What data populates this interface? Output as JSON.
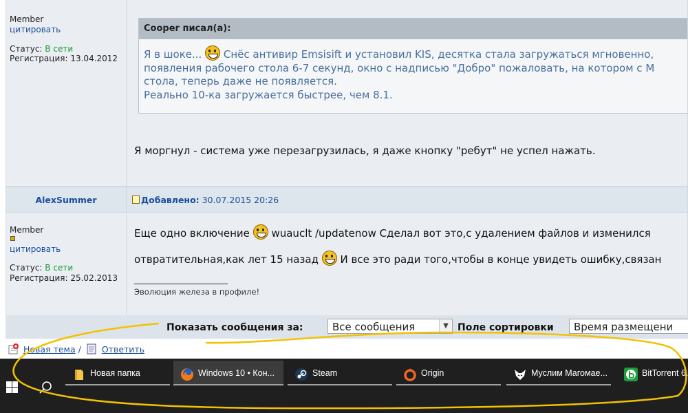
{
  "post1": {
    "user": {
      "rank": "Member",
      "quote_link": "цитировать",
      "status_label": "Статус:",
      "status_value": "В сети",
      "reg_label": "Регистрация:",
      "reg_date": "13.04.2012"
    },
    "quote": {
      "header": "Cooper писал(а):",
      "line1a": "Я в шоке...",
      "line1b": "Снёс антивир Emsisift и установил KIS, десятка стала загружаться мгновенно,",
      "line2": "появления рабочего стола 6-7 секунд, окно с надписью \"Добро\" пожаловать, на котором с М",
      "line3": "стола, теперь даже не появляется.",
      "line4": "Реально 10-ка загружается быстрее, чем 8.1."
    },
    "reply": "Я моргнул - система уже перезагрузилась, я даже кнопку \"ребут\" не успел нажать."
  },
  "post2": {
    "author": "AlexSummer",
    "added_label": "Добавлено:",
    "added_date": "30.07.2015 20:26",
    "user": {
      "rank": "Member",
      "quote_link": "цитировать",
      "status_label": "Статус:",
      "status_value": "В сети",
      "reg_label": "Регистрация:",
      "reg_date": "25.02.2013"
    },
    "line1a": "Еще одно включение",
    "line1b": "wuauclt /updatenow Сделал вот это,с удалением файлов и изменился",
    "line2a": "отвратительная,как лет 15 назад",
    "line2b": "И все это ради того,чтобы в конце увидеть ошибку,связан",
    "signature": "Эволюция железа в профиле!"
  },
  "toolbar": {
    "show_label": "Показать сообщения за:",
    "show_value": "Все сообщения",
    "sort_label": "Поле сортировки",
    "sort_value": "Время размещени"
  },
  "links": {
    "new_topic": "Новая тема",
    "separator": "/",
    "reply": "Ответить"
  },
  "taskbar": {
    "items": [
      {
        "label": "Новая папка",
        "icon": "folder-icon"
      },
      {
        "label": "Windows 10 • Кон...",
        "icon": "firefox-icon"
      },
      {
        "label": "Steam",
        "icon": "steam-icon"
      },
      {
        "label": "Origin",
        "icon": "origin-icon"
      },
      {
        "label": "Муслим Магомае...",
        "icon": "fox-icon"
      },
      {
        "label": "BitTorrent 6.",
        "icon": "bittorrent-icon"
      }
    ]
  },
  "colors": {
    "link": "#1a4e9c",
    "online": "#189a32",
    "quote_text": "#4a6f9c",
    "taskbar": "#1f1f1f",
    "annotation": "#f2c200"
  }
}
